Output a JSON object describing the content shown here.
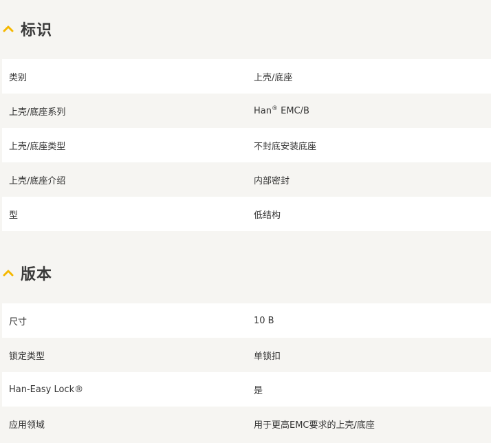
{
  "colors": {
    "accent": "#f5b800",
    "row_alt": "#ffffff",
    "page_bg": "#f6f5f2"
  },
  "sections": [
    {
      "title": "标识",
      "icon": "chevron-up-icon",
      "rows": [
        {
          "label": "类别",
          "value": "上壳/底座"
        },
        {
          "label": "上壳/底座系列",
          "value_prefix": "Han",
          "value_sup": "®",
          "value_suffix": " EMC/B"
        },
        {
          "label": "上壳/底座类型",
          "value": "不封底安装底座"
        },
        {
          "label": "上壳/底座介绍",
          "value": "内部密封"
        },
        {
          "label": "型",
          "value": "低结构"
        }
      ]
    },
    {
      "title": "版本",
      "icon": "chevron-up-icon",
      "rows": [
        {
          "label": "尺寸",
          "value": "10 B"
        },
        {
          "label": "锁定类型",
          "value": "单锁扣"
        },
        {
          "label": "Han-Easy Lock®",
          "value": "是"
        },
        {
          "label": "应用领域",
          "value": "用于更高EMC要求的上壳/底座"
        }
      ]
    }
  ]
}
